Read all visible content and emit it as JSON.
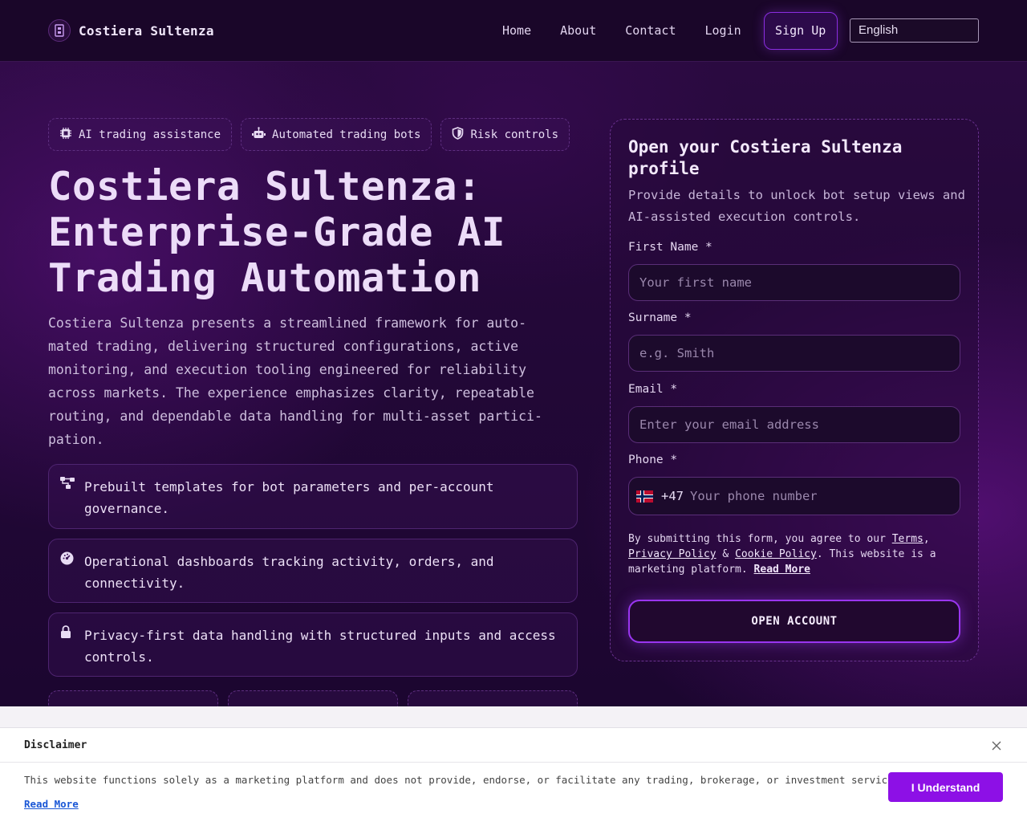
{
  "brand": {
    "name": "Costiera Sultenza"
  },
  "nav": {
    "links": [
      "Home",
      "About",
      "Contact",
      "Login"
    ],
    "signup": "Sign Up",
    "language": "English"
  },
  "chips": [
    {
      "icon": "chip-cpu-icon",
      "label": "AI trading assistance"
    },
    {
      "icon": "robot-icon",
      "label": "Automated trading bots"
    },
    {
      "icon": "shield-icon",
      "label": "Risk controls"
    }
  ],
  "hero": {
    "title": "Costiera Sultenza: Enterprise-Grade AI Trading Automation",
    "description": "Costiera Sultenza presents a streamlined framework for auto-mated trading, delivering structured configurations, active monitoring, and execution tooling engineered for reliability across markets. The experience emphasizes clarity, repeatable routing, and dependable data handling for multi-asset partici-pation."
  },
  "features": [
    {
      "icon": "nodes-icon",
      "text": "Prebuilt templates for bot parameters and per-account governance."
    },
    {
      "icon": "dashboard-icon",
      "text": "Operational dashboards tracking activity, orders, and connectivity."
    },
    {
      "icon": "lock-icon",
      "text": "Privacy-first data handling with structured inputs and access controls."
    }
  ],
  "form": {
    "title": "Open your Costiera Sultenza profile",
    "subtitle": "Provide details to unlock bot setup views and AI-assisted execution controls.",
    "first_name": {
      "label": "First Name *",
      "placeholder": "Your first name",
      "value": ""
    },
    "surname": {
      "label": "Surname *",
      "placeholder": "e.g. Smith",
      "value": ""
    },
    "email": {
      "label": "Email *",
      "placeholder": "Enter your email address",
      "value": ""
    },
    "phone": {
      "label": "Phone *",
      "dial_code": "+47",
      "placeholder": "Your phone number",
      "value": ""
    },
    "legal": {
      "prefix": "By submitting this form, you agree to our ",
      "terms": "Terms",
      "comma": ",",
      "privacy": "Privacy Policy",
      "amp": " & ",
      "cookie": "Cookie Policy",
      "middle": ". This website is a marketing platform. ",
      "read_more": "Read More"
    },
    "submit": "OPEN ACCOUNT"
  },
  "disclaimer": {
    "title": "Disclaimer",
    "text": "This website functions solely as a marketing platform and does not provide, endorse, or facilitate any trading, brokerage, or investment services.",
    "read_more": "Read More",
    "accept": "I Understand"
  },
  "colors": {
    "accent": "#8d10e6",
    "background": "#14041f",
    "link": "#1a57d6"
  }
}
